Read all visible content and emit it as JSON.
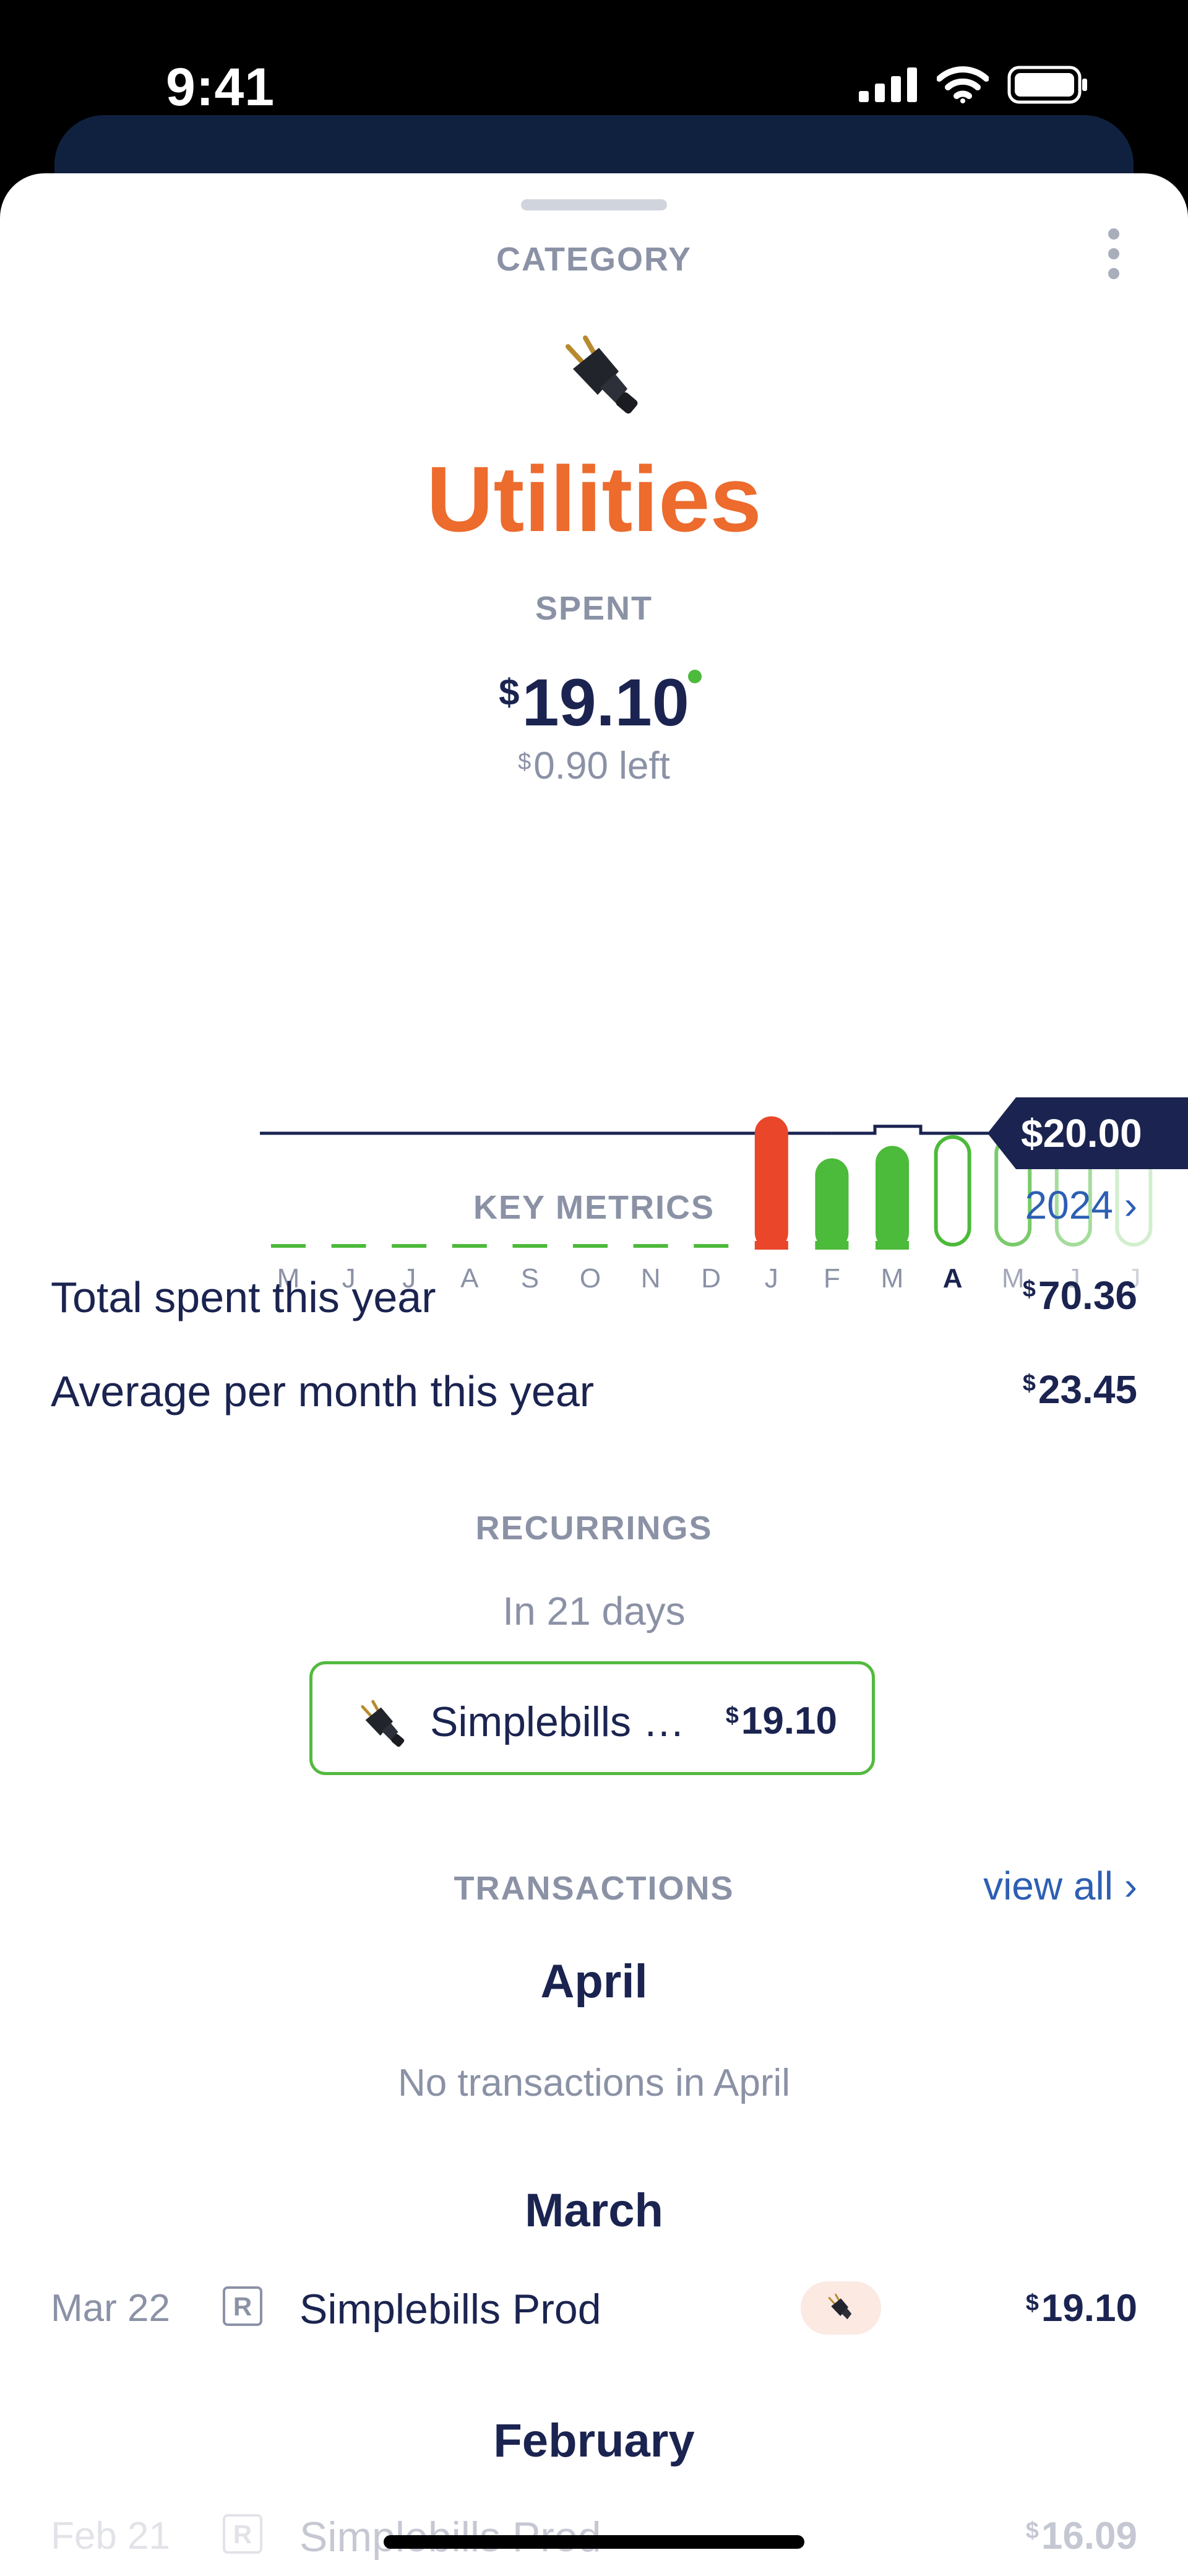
{
  "status": {
    "time": "9:41"
  },
  "header": {
    "section_label": "CATEGORY",
    "title": "Utilities",
    "icon": "plug-icon"
  },
  "spent": {
    "label": "SPENT",
    "currency": "$",
    "amount": "19.10",
    "left_amount": "0.90 left"
  },
  "chart_data": {
    "type": "bar",
    "categories": [
      "M",
      "J",
      "J",
      "A",
      "S",
      "O",
      "N",
      "D",
      "J",
      "F",
      "M",
      "A",
      "M",
      "J",
      "J"
    ],
    "values": [
      0,
      0,
      0,
      0,
      0,
      0,
      0,
      0,
      23.15,
      15.35,
      17.66,
      null,
      null,
      null,
      null
    ],
    "budget": [
      20,
      20,
      20,
      20,
      20,
      20,
      20,
      20,
      20,
      20,
      21.3,
      20,
      20,
      20,
      20
    ],
    "budget_label": "$20.00",
    "selected": "A",
    "colors": {
      "over": "#e9462a",
      "under": "#4cba3a",
      "budget_line": "#1b2450",
      "label": "#8b92a6"
    }
  },
  "metrics": {
    "label": "KEY METRICS",
    "year": "2024 ›",
    "rows": [
      {
        "label": "Total spent this year",
        "currency": "$",
        "value": "70.36"
      },
      {
        "label": "Average per month this year",
        "currency": "$",
        "value": "23.45"
      }
    ]
  },
  "recurrings": {
    "label": "RECURRINGS",
    "subtitle": "In 21 days",
    "item": {
      "name": "Simplebills …",
      "currency": "$",
      "amount": "19.10"
    }
  },
  "transactions": {
    "label": "TRANSACTIONS",
    "view_all": "view all ›",
    "months": [
      {
        "name": "April",
        "empty": "No transactions in April"
      },
      {
        "name": "March"
      },
      {
        "name": "February"
      }
    ],
    "rows": [
      {
        "date": "Mar 22",
        "badge": "R",
        "name": "Simplebills Prod",
        "currency": "$",
        "amount": "19.10"
      },
      {
        "date": "Feb 21",
        "badge": "R",
        "name": "Simplebills Prod",
        "currency": "$",
        "amount": "16.09"
      }
    ]
  }
}
